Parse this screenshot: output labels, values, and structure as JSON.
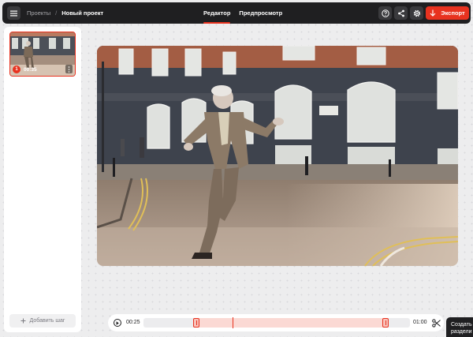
{
  "topbar": {
    "breadcrumb_root": "Проекты",
    "breadcrumb_sep": "/",
    "breadcrumb_current": "Новый проект",
    "tabs": [
      {
        "label": "Редактор",
        "active": true
      },
      {
        "label": "Предпросмотр",
        "active": false
      }
    ],
    "export_label": "Экспорт",
    "accent_color": "#e8321f"
  },
  "sidebar": {
    "steps": [
      {
        "number": "1",
        "duration": "00:35",
        "selected": true
      }
    ],
    "add_step_label": "Добавить шаг"
  },
  "timeline": {
    "start_time": "00:25",
    "end_time": "01:00"
  },
  "tooltip": {
    "line1": "Создать",
    "line2": "раздели"
  },
  "icons": {
    "menu": "hamburger-icon",
    "help": "help-icon",
    "share": "share-icon",
    "settings": "gear-icon",
    "export": "arrow-down-icon",
    "play": "play-icon",
    "cut": "scissors-icon",
    "add": "plus-icon",
    "more": "more-vertical-icon"
  }
}
